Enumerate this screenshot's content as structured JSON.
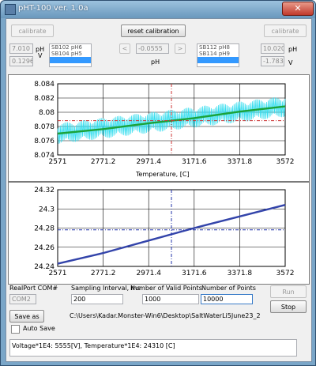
{
  "window": {
    "title": "pHT-100 ver. 1.0a",
    "close_glyph": "✕"
  },
  "calibrate_left": "calibrate",
  "reset_calibration": "reset calibration",
  "calibrate_right": "calibrate",
  "left_panel": {
    "ph_value": "7.010",
    "ph_unit": "pH",
    "v_value": "0.1296",
    "v_unit": "V",
    "list": [
      "SB102 pH6",
      "SB104 pH5",
      ""
    ]
  },
  "center_panel": {
    "left_arrow": "<",
    "value": "-0.0555",
    "right_arrow": ">",
    "unit": "pH"
  },
  "right_panel": {
    "list": [
      "SB112 pH8",
      "SB114 pH9",
      ""
    ],
    "ph_value": "10.020",
    "ph_unit": "pH",
    "v_value": "-1.7834",
    "v_unit": "V"
  },
  "chart_data": [
    {
      "type": "line",
      "xlabel": "Temperature, [C]",
      "x_ticks": [
        "2571",
        "2771.2",
        "2971.4",
        "3171.6",
        "3371.8",
        "3572"
      ],
      "y_ticks": [
        "8.084",
        "8.082",
        "8.08",
        "8.078",
        "8.076",
        "8.074"
      ],
      "xlim": [
        2571,
        3572
      ],
      "ylim": [
        8.0735,
        8.0845
      ],
      "series": [
        {
          "role": "raw",
          "color": "#33ddee",
          "x": [
            2571,
            3572
          ],
          "y": [
            8.0768,
            8.081
          ],
          "spread": 0.0016
        },
        {
          "role": "smoothed",
          "color": "#1aa33a",
          "x": [
            2571,
            2771.2,
            2971.4,
            3171.6,
            3371.8,
            3572
          ],
          "y": [
            8.0768,
            8.0775,
            8.0784,
            8.0792,
            8.0802,
            8.081
          ]
        }
      ],
      "crosshair": {
        "x": 3071.5,
        "y": 8.0788,
        "color": "#cc3333"
      }
    },
    {
      "type": "line",
      "xlabel": "",
      "x_ticks": [
        "2571",
        "2771.2",
        "2971.4",
        "3171.6",
        "3371.8",
        "3572"
      ],
      "y_ticks": [
        "24.32",
        "24.3",
        "24.28",
        "24.26",
        "24.24"
      ],
      "xlim": [
        2571,
        3572
      ],
      "ylim": [
        24.238,
        24.324
      ],
      "series": [
        {
          "role": "raw",
          "color": "#cc3333",
          "x": [
            2571,
            2771.2,
            2971.4,
            3171.6,
            3371.8,
            3572
          ],
          "y": [
            24.241,
            24.253,
            24.267,
            24.281,
            24.294,
            24.307
          ]
        },
        {
          "role": "smoothed",
          "color": "#3344aa",
          "x": [
            2571,
            2771.2,
            2971.4,
            3171.6,
            3371.8,
            3572
          ],
          "y": [
            24.241,
            24.253,
            24.267,
            24.281,
            24.294,
            24.307
          ]
        }
      ],
      "crosshair": {
        "x": 3071.5,
        "y": 24.279,
        "color": "#2233aa"
      }
    }
  ],
  "controls": {
    "port_label": "RealPort COM#",
    "port_value": "COM2",
    "interval_label": "Sampling Interval, ms",
    "interval_value": "200",
    "valid_label": "Number of Valid Points",
    "valid_value": "1000",
    "points_label": "Number of Points",
    "points_value": "10000",
    "run": "Run",
    "save_as": "Save as",
    "stop": "Stop",
    "path": "C:\\Users\\Kadar.Monster-Win6\\Desktop\\SaltWaterLi5June23_2",
    "auto_save": "Auto Save"
  },
  "status": "Voltage*1E4:  5555[V], Temperature*1E4: 24310 [C]"
}
